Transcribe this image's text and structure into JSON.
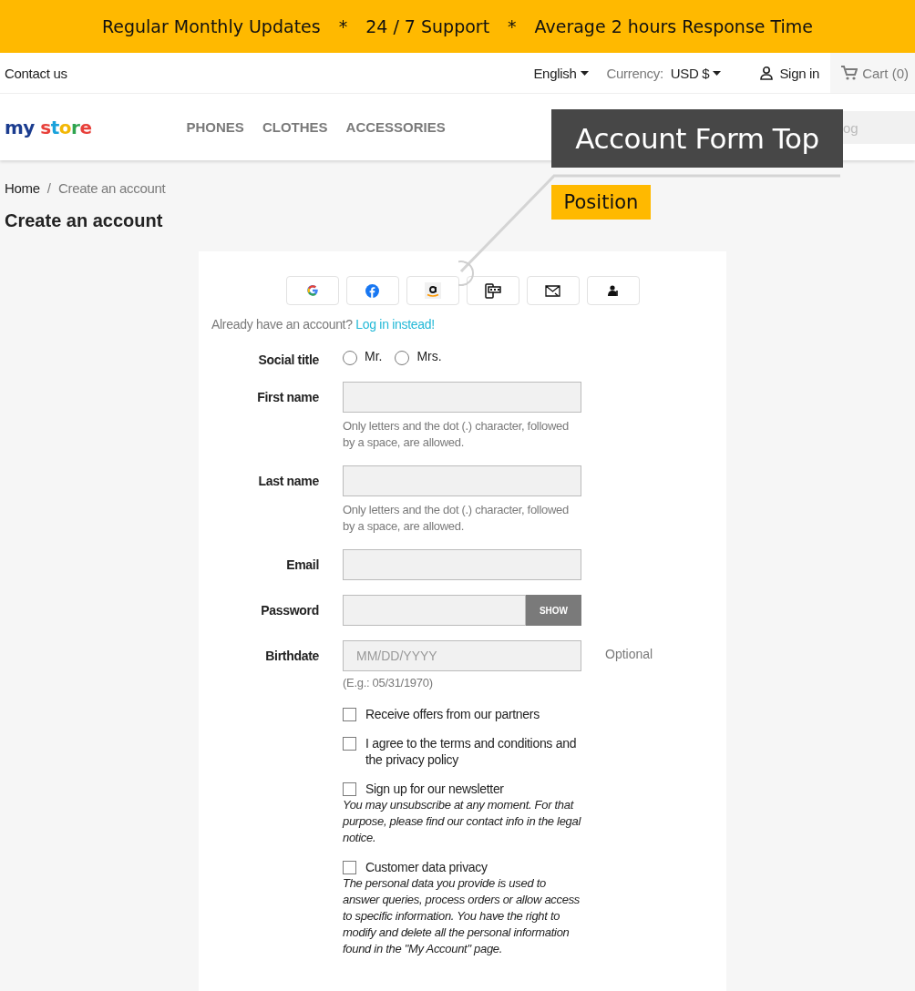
{
  "banner": {
    "items": [
      "Regular Monthly Updates",
      "*",
      "24 / 7 Support",
      "*",
      "Average 2 hours Response Time"
    ]
  },
  "top_bar": {
    "contact": "Contact us",
    "language": "English",
    "currency_label": "Currency:",
    "currency": "USD $",
    "sign_in": "Sign in",
    "cart": "Cart (0)"
  },
  "header": {
    "logo": "my store",
    "menu": [
      "PHONES",
      "CLOTHES",
      "ACCESSORIES"
    ],
    "search": {
      "placeholder": "og"
    }
  },
  "annotation": {
    "title": "Account Form Top",
    "tag": "Position"
  },
  "breadcrumb": {
    "items": [
      "Home",
      "Create an account"
    ],
    "separator": "/"
  },
  "page_title": "Create an account",
  "social_buttons": [
    {
      "kind": "google"
    },
    {
      "kind": "facebook"
    },
    {
      "kind": "amazon"
    },
    {
      "kind": "phone"
    },
    {
      "kind": "email"
    },
    {
      "kind": "user"
    }
  ],
  "login_prompt": {
    "text": "Already have an account?",
    "link": "Log in instead!"
  },
  "fields": [
    {
      "kind": "radio",
      "label": "Social title",
      "options": [
        {
          "label": "Mr.",
          "selected": false
        },
        {
          "label": "Mrs.",
          "selected": false
        }
      ]
    },
    {
      "kind": "text",
      "label": "First name",
      "hint": "Only letters and the dot (.) character, followed by a space, are allowed."
    },
    {
      "kind": "text",
      "label": "Last name",
      "hint": "Only letters and the dot (.) character, followed by a space, are allowed."
    },
    {
      "kind": "text",
      "label": "Email"
    },
    {
      "kind": "password",
      "label": "Password",
      "button": "SHOW"
    },
    {
      "kind": "date",
      "label": "Birthdate",
      "placeholder": "MM/DD/YYYY",
      "optional": "Optional",
      "hint": "(E.g.: 05/31/1970)"
    }
  ],
  "checkboxes": [
    {
      "label": "Receive offers from our partners",
      "checked": false
    },
    {
      "label": "I agree to the terms and conditions and the privacy policy",
      "checked": false
    },
    {
      "label": "Sign up for our newsletter",
      "checked": false,
      "note": "You may unsubscribe at any moment. For that purpose, please find our contact info in the legal notice."
    },
    {
      "label": "Customer data privacy",
      "checked": false,
      "note": "The personal data you provide is used to answer queries, process orders or allow access to specific information. You have the right to modify and delete all the personal information found in the \"My Account\" page."
    }
  ]
}
